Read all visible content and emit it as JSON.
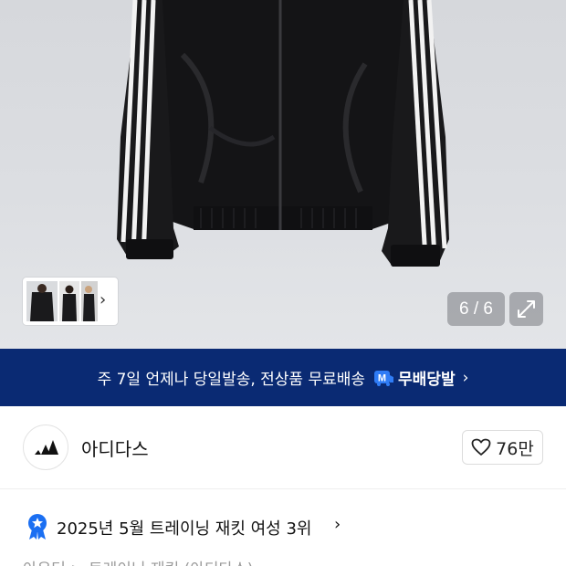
{
  "gallery": {
    "counter": "6 / 6",
    "icons": {
      "expand": "expand-icon",
      "next": "chevron-right-icon"
    }
  },
  "promo": {
    "text": "주 7일 언제나 당일발송, 전상품 무료배송",
    "badge_letter": "M",
    "badge_label": "무배당발",
    "color": "#0a2a73"
  },
  "brand": {
    "name": "아디다스",
    "like_count": "76만",
    "icons": {
      "logo": "adidas-logo-icon",
      "like": "heart-icon"
    }
  },
  "ranking": {
    "text": "2025년 5월 트레이닝 재킷 여성 3위"
  },
  "breadcrumb": {
    "text": "아우터 > 트레이닝 재킷 (아디다스)"
  }
}
